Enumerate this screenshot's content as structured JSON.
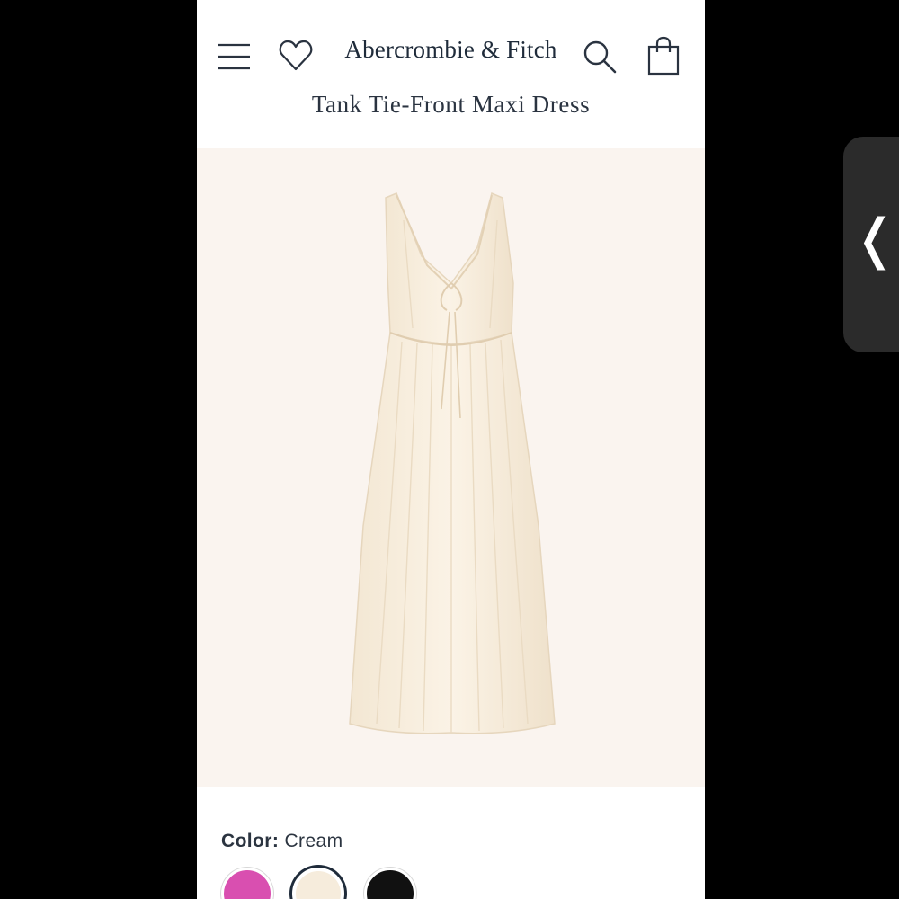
{
  "header": {
    "brand": "Abercrombie & Fitch",
    "icons": [
      "menu-icon",
      "heart-icon",
      "search-icon",
      "shopping-bag-icon"
    ]
  },
  "product": {
    "title": "Tank Tie-Front Maxi Dress",
    "color_label": "Color:",
    "color_value": "Cream",
    "swatches": [
      {
        "name": "pink",
        "color": "#d94fb0"
      },
      {
        "name": "cream",
        "color": "#f6ecdc",
        "selected": true
      },
      {
        "name": "black",
        "color": "#111111"
      }
    ]
  },
  "overlay": {
    "side_tab_icon": "chevron-left-icon",
    "side_tab_glyph": "❬"
  },
  "colors": {
    "brand_text": "#1f2b3a",
    "image_background": "#faf4ef",
    "page_background": "#000000"
  }
}
